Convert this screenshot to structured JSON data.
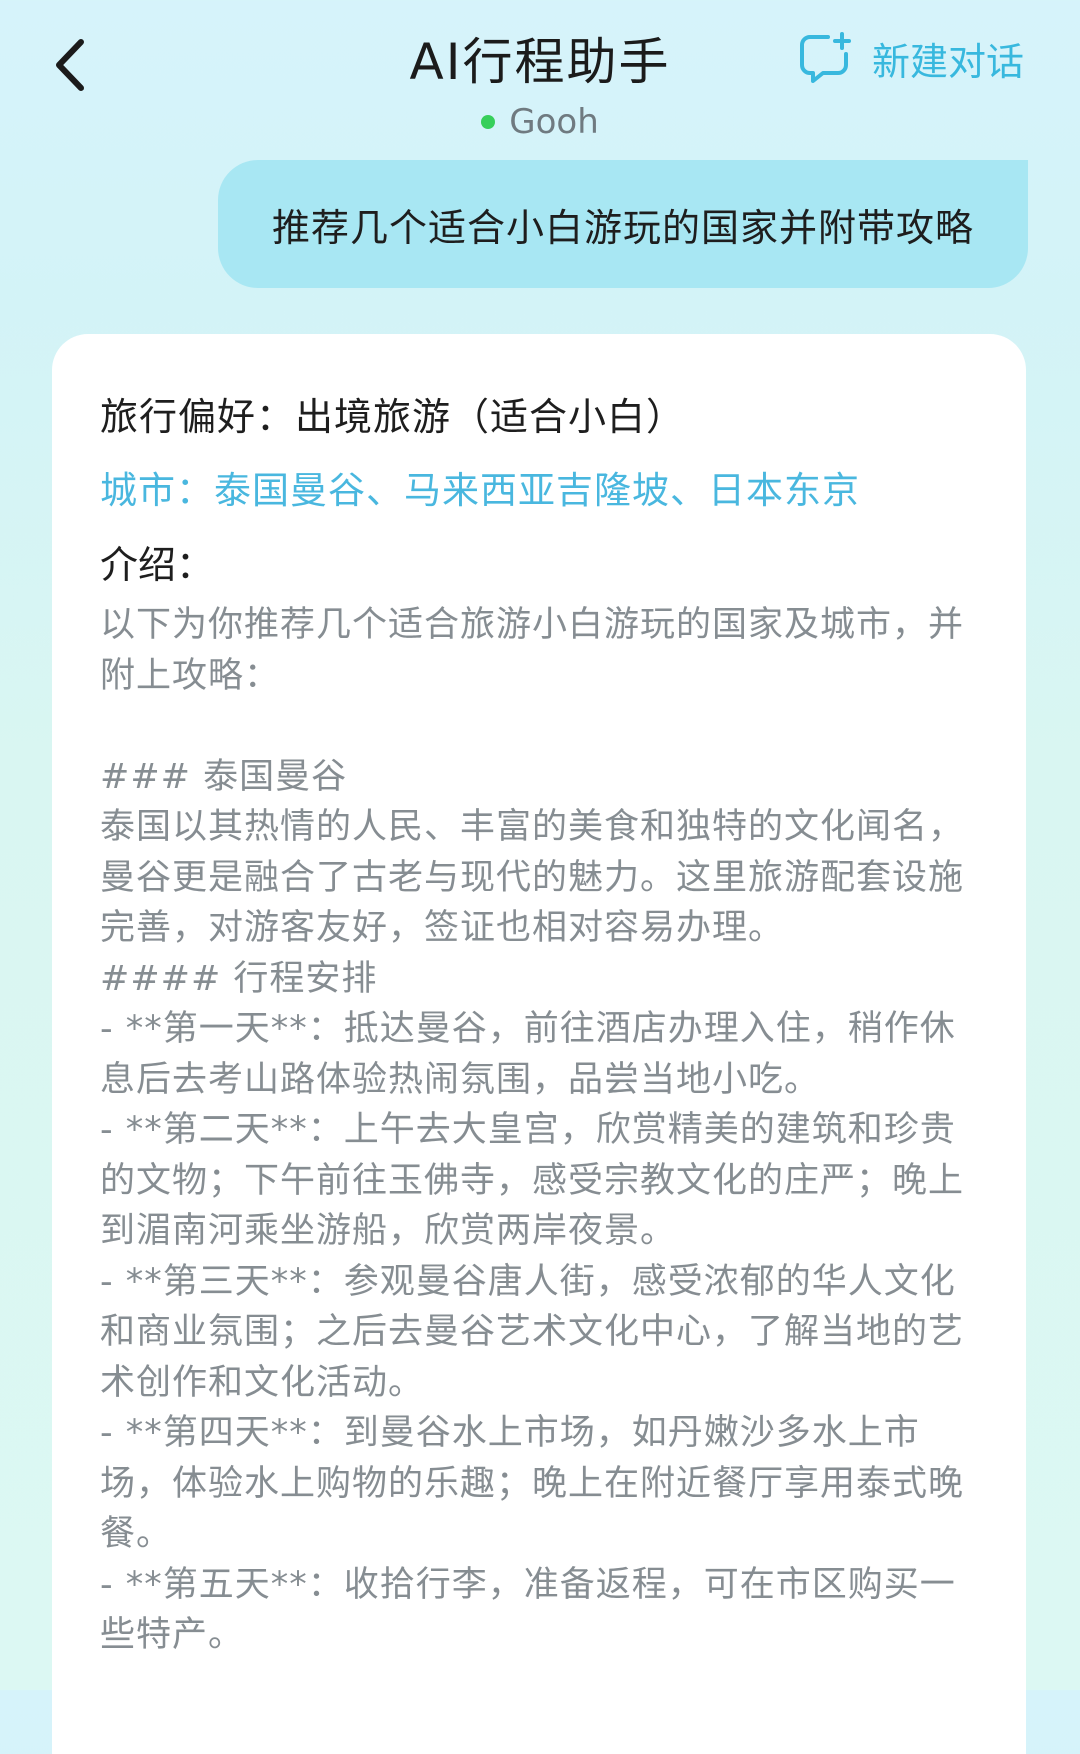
{
  "header": {
    "title": "AI行程助手",
    "status": "Gooh",
    "new_chat_label": "新建对话",
    "back_icon": "chevron-left-icon",
    "new_chat_icon": "chat-add-icon",
    "status_color": "#36cf5a",
    "accent_color": "#38b8de"
  },
  "user_message": {
    "text": "推荐几个适合小白游玩的国家并附带攻略"
  },
  "answer": {
    "preference": "旅行偏好：出境旅游（适合小白）",
    "cities": "城市：泰国曼谷、马来西亚吉隆坡、日本东京",
    "intro_label": "介绍：",
    "body": "以下为你推荐几个适合旅游小白游玩的国家及城市，并附上攻略：\n\n### 泰国曼谷\n泰国以其热情的人民、丰富的美食和独特的文化闻名，曼谷更是融合了古老与现代的魅力。这里旅游配套设施完善，对游客友好，签证也相对容易办理。\n#### 行程安排\n- **第一天**：抵达曼谷，前往酒店办理入住，稍作休息后去考山路体验热闹氛围，品尝当地小吃。\n- **第二天**：上午去大皇宫，欣赏精美的建筑和珍贵的文物；下午前往玉佛寺，感受宗教文化的庄严；晚上到湄南河乘坐游船，欣赏两岸夜景。\n- **第三天**：参观曼谷唐人街，感受浓郁的华人文化和商业氛围；之后去曼谷艺术文化中心，了解当地的艺术创作和文化活动。\n- **第四天**：到曼谷水上市场，如丹嫩沙多水上市场，体验水上购物的乐趣；晚上在附近餐厅享用泰式晚餐。\n- **第五天**：收拾行李，准备返程，可在市区购买一些特产。"
  }
}
